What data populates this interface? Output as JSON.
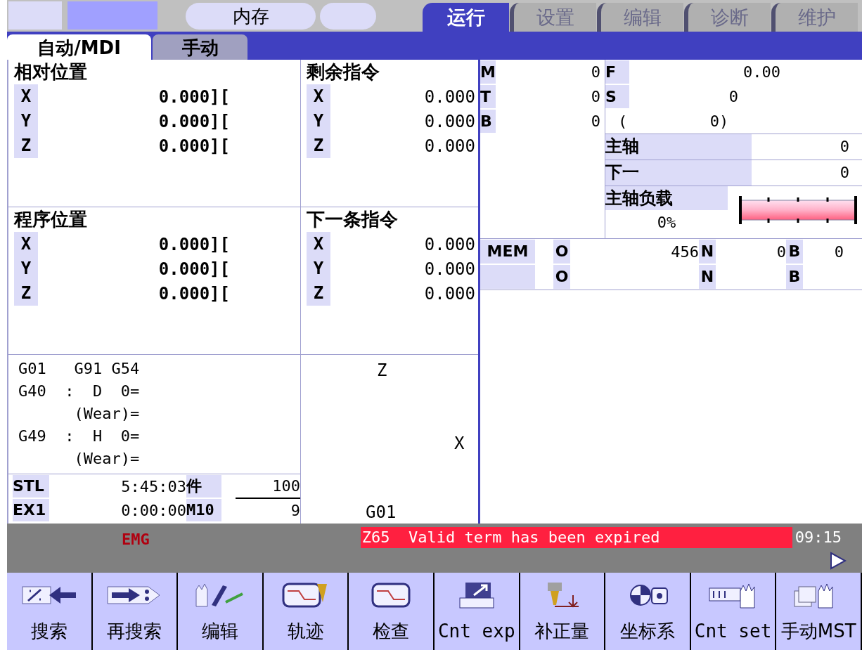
{
  "top_bar": {
    "mode_label": "内存",
    "tabs": [
      {
        "label": "运行",
        "selected": true
      },
      {
        "label": "设置",
        "selected": false
      },
      {
        "label": "编辑",
        "selected": false
      },
      {
        "label": "诊断",
        "selected": false
      },
      {
        "label": "维护",
        "selected": false
      }
    ]
  },
  "sub_tabs": [
    {
      "label": "自动/MDI",
      "selected": true
    },
    {
      "label": "手动",
      "selected": false
    }
  ],
  "relative_position": {
    "title": "相对位置",
    "axes": [
      {
        "axis": "X",
        "value": "0.000]["
      },
      {
        "axis": "Y",
        "value": "0.000]["
      },
      {
        "axis": "Z",
        "value": "0.000]["
      }
    ]
  },
  "remaining_command": {
    "title": "剩余指令",
    "axes": [
      {
        "axis": "X",
        "value": "0.000"
      },
      {
        "axis": "Y",
        "value": "0.000"
      },
      {
        "axis": "Z",
        "value": "0.000"
      }
    ]
  },
  "program_position": {
    "title": "程序位置",
    "axes": [
      {
        "axis": "X",
        "value": "0.000]["
      },
      {
        "axis": "Y",
        "value": "0.000]["
      },
      {
        "axis": "Z",
        "value": "0.000]["
      }
    ]
  },
  "next_command": {
    "title": "下一条指令",
    "axes": [
      {
        "axis": "X",
        "value": "0.000"
      },
      {
        "axis": "Y",
        "value": "0.000"
      },
      {
        "axis": "Z",
        "value": "0.000"
      }
    ]
  },
  "modal_lines": [
    "G01   G91 G54",
    "G40  :  D  0=",
    "      (Wear)=",
    "G49  :  H  0=",
    "      (Wear)="
  ],
  "counters": [
    {
      "label": "STL",
      "value": "5:45:03",
      "label2": "件",
      "value2": "100"
    },
    {
      "label": "EX1",
      "value": "0:00:00",
      "label2": "M10",
      "value2": "9"
    }
  ],
  "plot": {
    "z_label": "Z",
    "x_label": "X",
    "gcode": "G01"
  },
  "mtb": [
    {
      "label": "M",
      "value": "0"
    },
    {
      "label": "T",
      "value": "0"
    },
    {
      "label": "B",
      "value": "0"
    }
  ],
  "feed": [
    {
      "label": "F",
      "value": "0.00"
    },
    {
      "label": "S",
      "value": "0"
    }
  ],
  "spindle_paren": {
    "open": "(",
    "value": "0)"
  },
  "spindle": [
    {
      "label": "主轴",
      "value": "0"
    },
    {
      "label": "下一",
      "value": "0"
    }
  ],
  "spindle_load": {
    "label": "主轴负载",
    "reading": "0%"
  },
  "program_info": {
    "mode": "MEM",
    "rows": [
      [
        {
          "label": "O",
          "value": "456"
        },
        {
          "label": "N",
          "value": "0"
        },
        {
          "label": "B",
          "value": "0"
        }
      ],
      [
        {
          "label": "O"
        },
        {
          "label": "N"
        },
        {
          "label": "B"
        }
      ]
    ]
  },
  "status": {
    "emg": "EMG",
    "alarm": "Z65  Valid term has been expired",
    "time": "09:15"
  },
  "softkeys": [
    {
      "label": "搜索",
      "kind": "search"
    },
    {
      "label": "再搜索",
      "kind": "research"
    },
    {
      "label": "编辑",
      "kind": "edit"
    },
    {
      "label": "轨迹",
      "kind": "trace"
    },
    {
      "label": "检查",
      "kind": "check"
    },
    {
      "label": "Cnt exp",
      "kind": "cntexp"
    },
    {
      "label": "补正量",
      "kind": "offset"
    },
    {
      "label": "坐标系",
      "kind": "coord"
    },
    {
      "label": "Cnt set",
      "kind": "cntset"
    },
    {
      "label": "手动MST",
      "kind": "mst"
    }
  ]
}
